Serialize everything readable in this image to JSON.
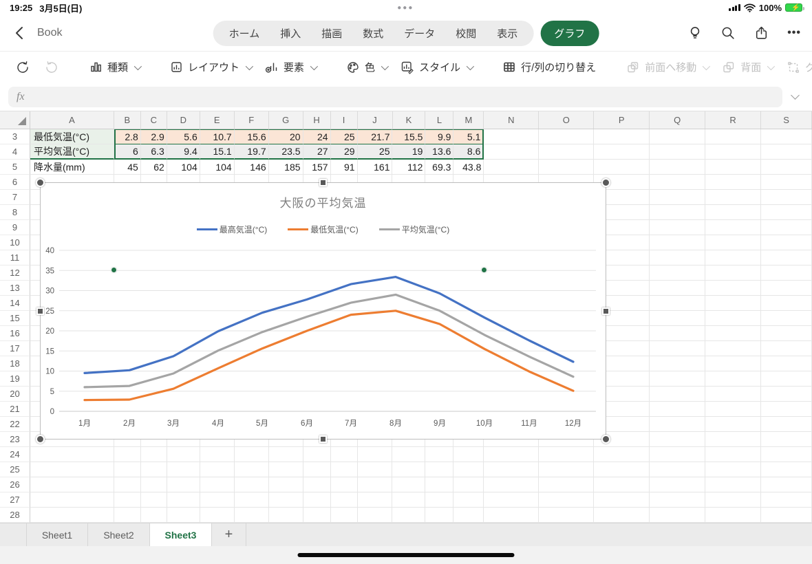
{
  "status_bar": {
    "time": "19:25",
    "date": "3月5日(日)",
    "battery_percent": "100%"
  },
  "title_bar": {
    "document_title": "Book",
    "tabs": [
      "ホーム",
      "挿入",
      "描画",
      "数式",
      "データ",
      "校閲",
      "表示"
    ],
    "active_tab": "グラフ"
  },
  "toolbar": {
    "items": [
      {
        "label": "種類",
        "icon": "chart-type-icon",
        "enabled": true,
        "chevron": true
      },
      {
        "label": "レイアウト",
        "icon": "chart-layout-icon",
        "enabled": true,
        "chevron": true
      },
      {
        "label": "要素",
        "icon": "chart-elements-icon",
        "enabled": true,
        "chevron": true
      },
      {
        "label": "色",
        "icon": "color-palette-icon",
        "enabled": true,
        "chevron": true
      },
      {
        "label": "スタイル",
        "icon": "chart-style-icon",
        "enabled": true,
        "chevron": true
      },
      {
        "label": "行/列の切り替え",
        "icon": "switch-row-column-icon",
        "enabled": true,
        "chevron": false
      },
      {
        "label": "前面へ移動",
        "icon": "bring-forward-icon",
        "enabled": false,
        "chevron": true
      },
      {
        "label": "背面",
        "icon": "send-backward-icon",
        "enabled": false,
        "chevron": true
      },
      {
        "label": "グループ",
        "icon": "group-icon",
        "enabled": false,
        "chevron": true
      }
    ]
  },
  "formula_bar": {
    "fx": "fx",
    "value": ""
  },
  "grid": {
    "columns": [
      "A",
      "B",
      "C",
      "D",
      "E",
      "F",
      "G",
      "H",
      "I",
      "J",
      "K",
      "L",
      "M",
      "N",
      "O",
      "P",
      "Q",
      "R",
      "S"
    ],
    "row_numbers": [
      3,
      4,
      5,
      6,
      7,
      8,
      9,
      10,
      11,
      12,
      13,
      14,
      15,
      16,
      17,
      18,
      19,
      20,
      21,
      22,
      23,
      24,
      25,
      26,
      27,
      28
    ],
    "data_rows": [
      {
        "row": 3,
        "label": "最低気温(°C)",
        "values": [
          "2.8",
          "2.9",
          "5.6",
          "10.7",
          "15.6",
          "20",
          "24",
          "25",
          "21.7",
          "15.5",
          "9.9",
          "5.1"
        ]
      },
      {
        "row": 4,
        "label": "平均気温(°C)",
        "values": [
          "6",
          "6.3",
          "9.4",
          "15.1",
          "19.7",
          "23.5",
          "27",
          "29",
          "25",
          "19",
          "13.6",
          "8.6"
        ]
      },
      {
        "row": 5,
        "label": "降水量(mm)",
        "values": [
          "45",
          "62",
          "104",
          "104",
          "146",
          "185",
          "157",
          "91",
          "161",
          "112",
          "69.3",
          "43.8"
        ]
      }
    ]
  },
  "chart_data": {
    "type": "line",
    "title": "大阪の平均気温",
    "categories": [
      "1月",
      "2月",
      "3月",
      "4月",
      "5月",
      "6月",
      "7月",
      "8月",
      "9月",
      "10月",
      "11月",
      "12月"
    ],
    "series": [
      {
        "name": "最高気温(°C)",
        "color": "#4472c4",
        "values": [
          9.5,
          10.2,
          13.7,
          19.9,
          24.5,
          27.8,
          31.6,
          33.4,
          29.3,
          23.3,
          17.6,
          12.3
        ]
      },
      {
        "name": "最低気温(°C)",
        "color": "#ed7d31",
        "values": [
          2.8,
          2.9,
          5.6,
          10.7,
          15.6,
          20,
          24,
          25,
          21.7,
          15.5,
          9.9,
          5.1
        ]
      },
      {
        "name": "平均気温(°C)",
        "color": "#a5a5a5",
        "values": [
          6,
          6.3,
          9.4,
          15.1,
          19.7,
          23.5,
          27,
          29,
          25,
          19,
          13.6,
          8.6
        ]
      }
    ],
    "ylim": [
      0,
      40
    ],
    "ytick_step": 5,
    "grid": true,
    "legend_position": "top"
  },
  "sheet_tabs": {
    "items": [
      "Sheet1",
      "Sheet2",
      "Sheet3"
    ],
    "active": "Sheet3",
    "add_label": "+"
  },
  "colors": {
    "accent_green": "#217346",
    "series_row_fill_orange": "#fbe5d6",
    "series_row_fill_gray": "#ededed",
    "label_fill_green": "#e9f1e9"
  }
}
